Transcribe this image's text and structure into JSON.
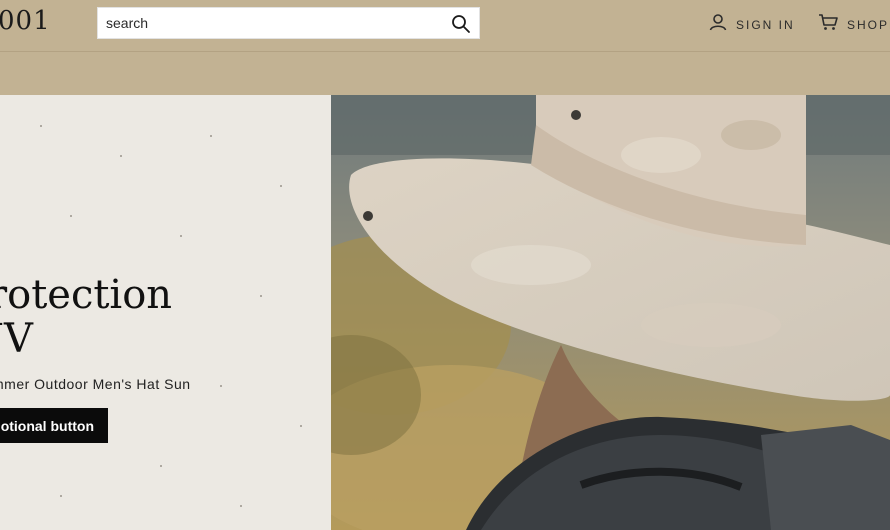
{
  "header": {
    "logo_text": "001",
    "search": {
      "placeholder": "search",
      "value": ""
    },
    "sign_in_label": "SIGN IN",
    "cart_label": "SHOPP"
  },
  "hero": {
    "title": "rotection\nJV",
    "subtitle": "mmer Outdoor Men's Hat Sun",
    "button_label": "otional button",
    "image_description_icon": "hat-photo"
  },
  "colors": {
    "header_bg": "#c2b293",
    "hero_left_bg": "#ece9e3",
    "button_bg": "#0b0b0b"
  }
}
